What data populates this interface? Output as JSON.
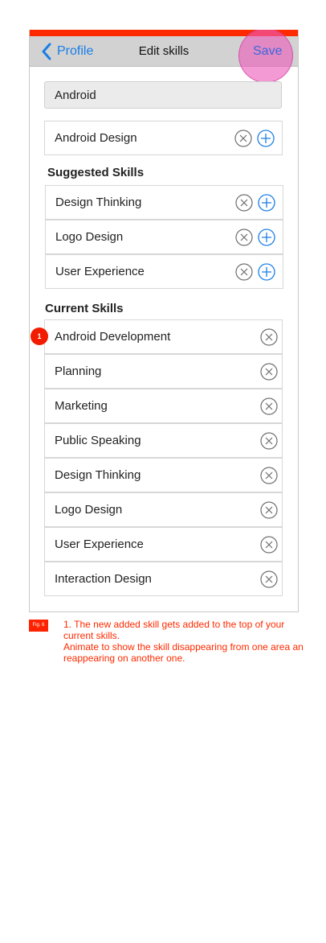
{
  "nav": {
    "back_label": "Profile",
    "title": "Edit skills",
    "save_label": "Save"
  },
  "search": {
    "value": "Android"
  },
  "search_result": {
    "label": "Android Design",
    "icons": [
      "remove-icon",
      "add-icon"
    ]
  },
  "suggested": {
    "heading": "Suggested Skills",
    "items": [
      {
        "label": "Design Thinking"
      },
      {
        "label": "Logo Design"
      },
      {
        "label": "User Experience"
      }
    ]
  },
  "current": {
    "heading": "Current Skills",
    "badge": "1",
    "items": [
      {
        "label": "Android Development"
      },
      {
        "label": "Planning"
      },
      {
        "label": "Marketing"
      },
      {
        "label": "Public Speaking"
      },
      {
        "label": "Design Thinking"
      },
      {
        "label": "Logo Design"
      },
      {
        "label": "User Experience"
      },
      {
        "label": "Interaction Design"
      }
    ]
  },
  "annotation": {
    "fig_label": "Fig. 6",
    "line1": "1. The new added skill gets added to the top of your current skills.",
    "line2": "Animate to show the skill disappearing from one area an reappearing on another one."
  },
  "colors": {
    "accent": "#1a7ee6",
    "annotation_red": "#ff2a00",
    "highlight": "#ec5aba"
  }
}
